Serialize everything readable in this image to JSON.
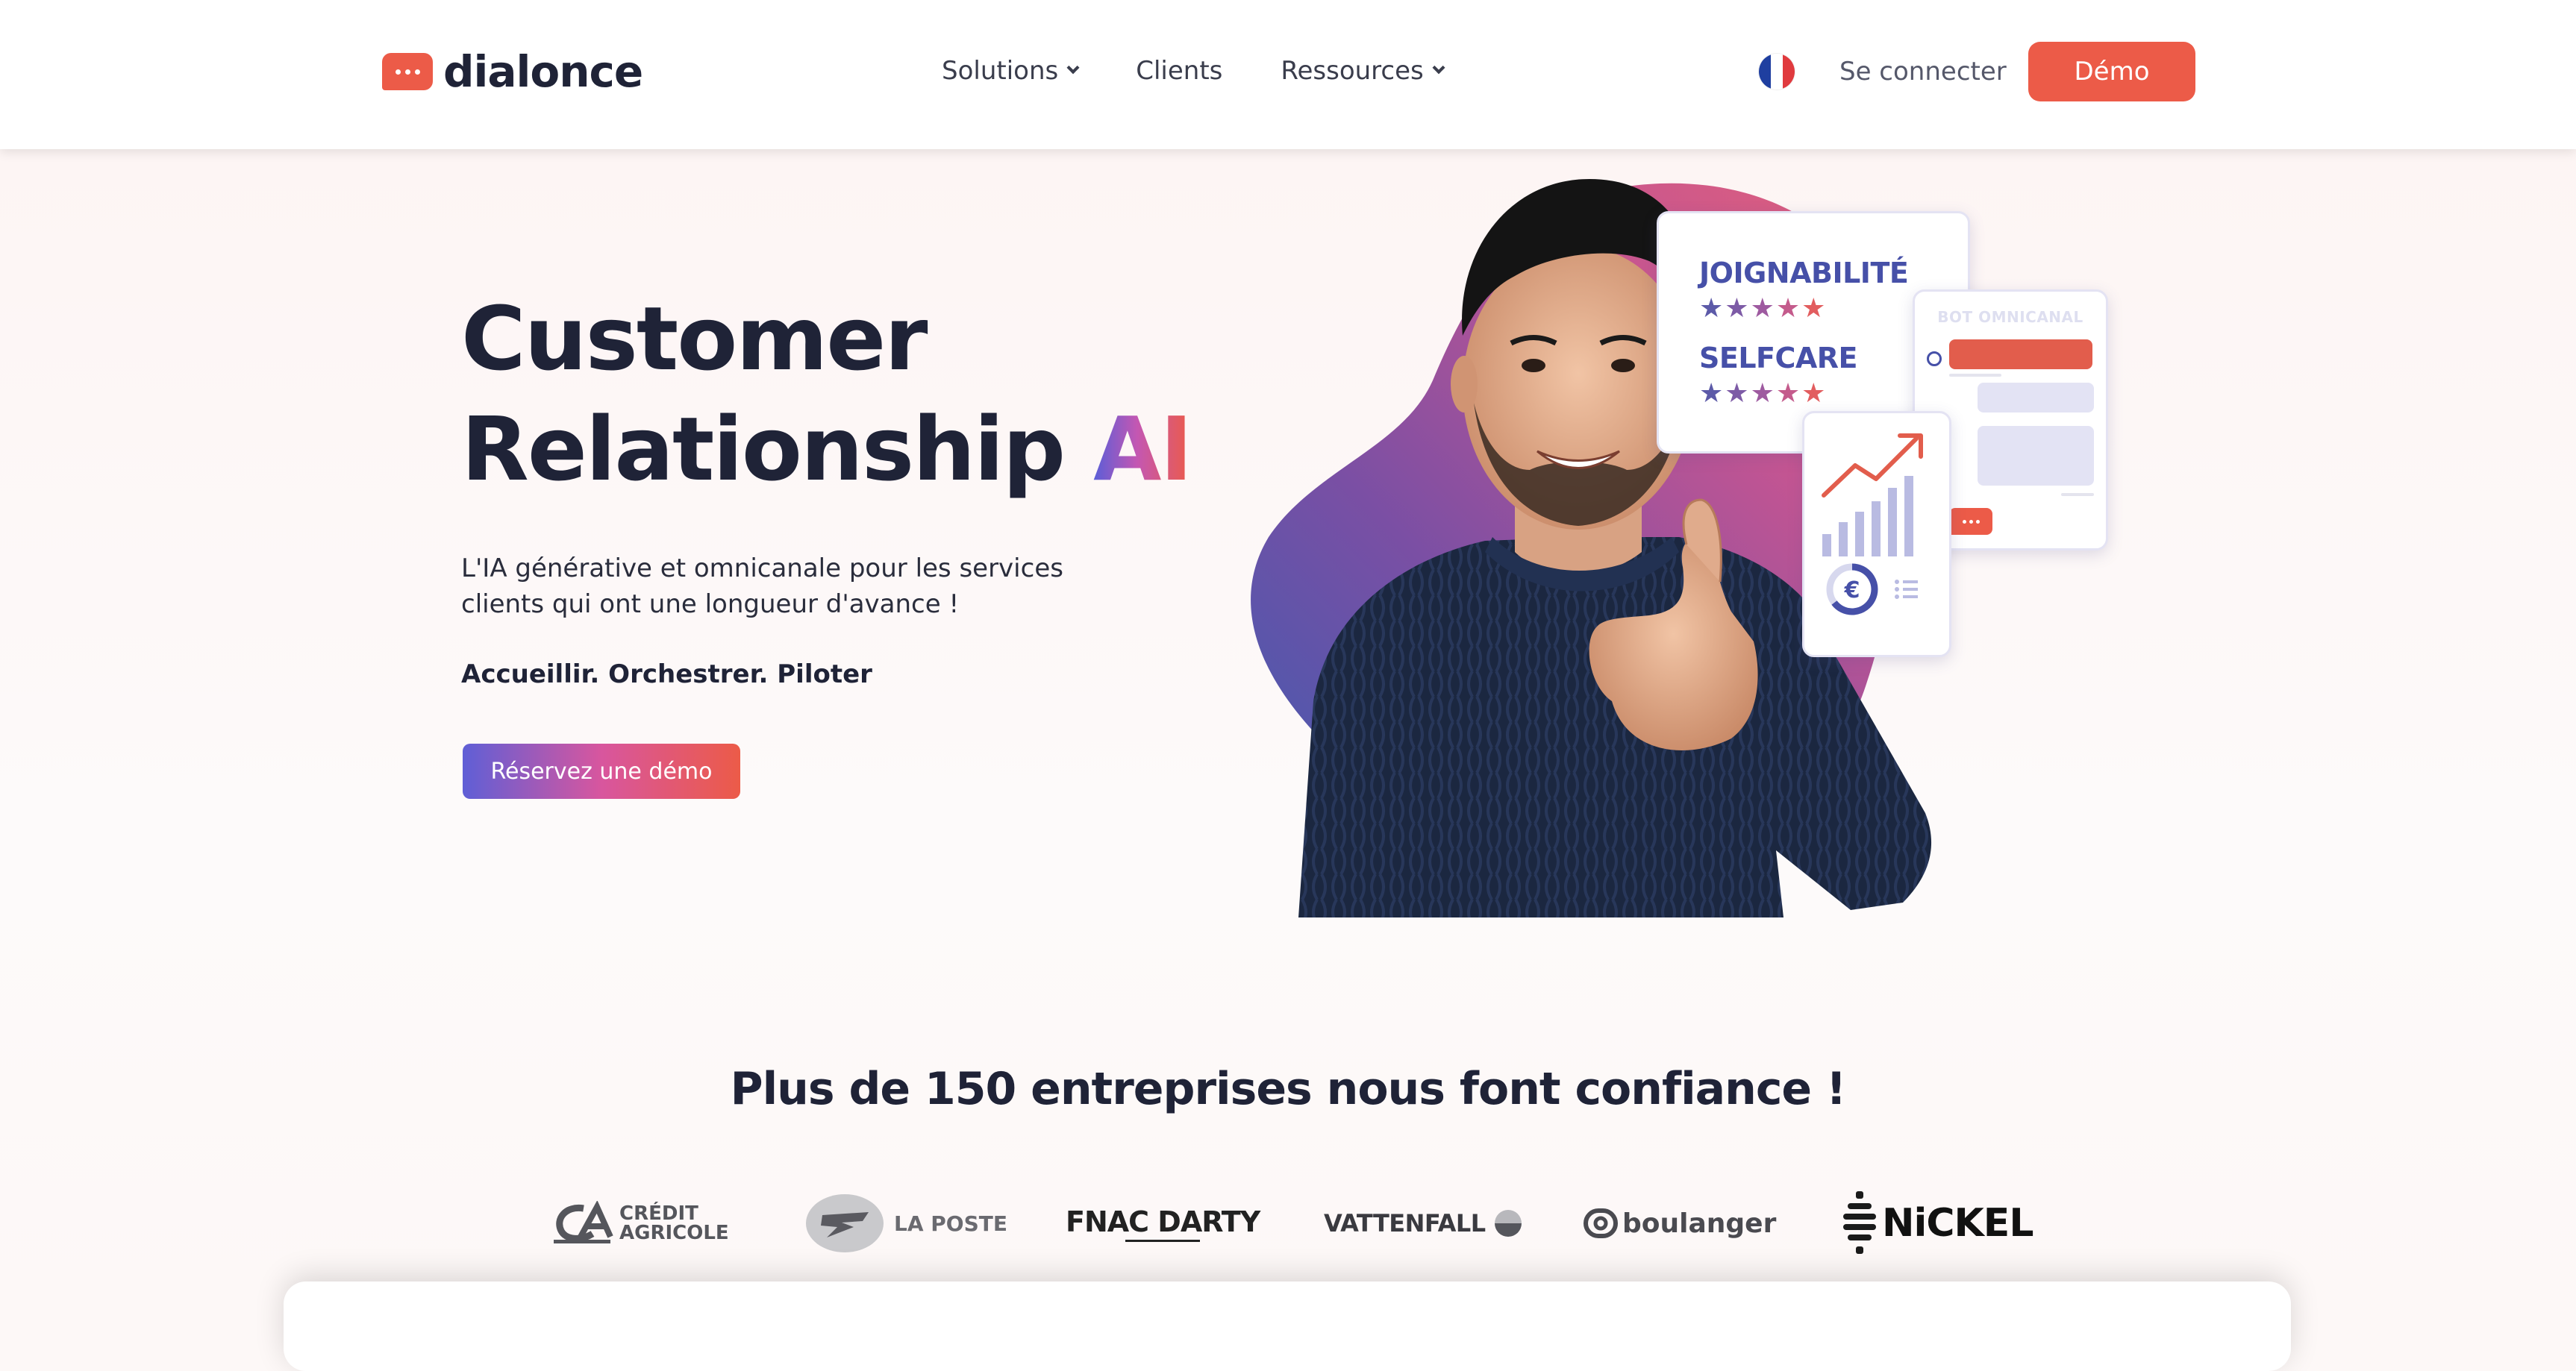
{
  "brand": {
    "name": "dialonce",
    "accent": "#ec5b48",
    "dark": "#1f2337"
  },
  "nav": {
    "items": [
      {
        "label": "Solutions",
        "dropdown": true
      },
      {
        "label": "Clients",
        "dropdown": false
      },
      {
        "label": "Ressources",
        "dropdown": true
      }
    ],
    "language_flag": "french-flag-icon",
    "login_label": "Se connecter",
    "demo_label": "Démo"
  },
  "hero": {
    "title_line1": "Customer",
    "title_line2": "Relationship",
    "title_highlight": "AI",
    "subtitle": "L'IA générative et omnicanale pour les services clients qui ont une longueur d'avance !",
    "tagline": "Accueillir. Orchestrer. Piloter",
    "cta_label": "Réservez une démo"
  },
  "illustration": {
    "rating_card": {
      "label1": "JOIGNABILITÉ",
      "label2": "SELFCARE",
      "stars": "★★★★★"
    },
    "bot_card": {
      "title": "BOT OMNICANAL"
    },
    "chart_card": {
      "currency_symbol": "€"
    }
  },
  "trust": {
    "title": "Plus de 150 entreprises nous font confiance !",
    "logos": [
      {
        "name": "credit-agricole-logo",
        "line1": "CRÉDIT",
        "line2": "AGRICOLE"
      },
      {
        "name": "la-poste-logo",
        "text": "LA POSTE"
      },
      {
        "name": "fnac-darty-logo",
        "text": "FNAC DARTY"
      },
      {
        "name": "vattenfall-logo",
        "text": "VATTENFALL"
      },
      {
        "name": "boulanger-logo",
        "text": "boulanger"
      },
      {
        "name": "nickel-logo",
        "text": "NiCKEL"
      }
    ]
  }
}
